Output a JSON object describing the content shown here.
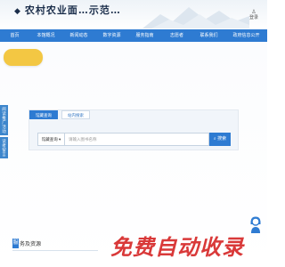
{
  "header": {
    "site_title": "农村农业面…示范…",
    "login_label": "登录"
  },
  "nav": {
    "items": [
      {
        "label": "首页"
      },
      {
        "label": "本馆概况"
      },
      {
        "label": "新闻动态"
      },
      {
        "label": "数字资源"
      },
      {
        "label": "服务指南"
      },
      {
        "label": "志愿者"
      },
      {
        "label": "联系我们"
      },
      {
        "label": "政府信息公开"
      }
    ]
  },
  "left_float": {
    "items": [
      {
        "label": "阅读推广活动"
      },
      {
        "label": "读者留言"
      }
    ]
  },
  "search": {
    "tabs": [
      {
        "label": "馆藏查询",
        "active": true
      },
      {
        "label": "站内搜索",
        "active": false
      }
    ],
    "select_value": "馆藏查询 ▾",
    "placeholder": "请输入图书名称",
    "button_label": "搜索"
  },
  "bottom": {
    "section_badge": "服",
    "section_title": "务及资源"
  },
  "watermark": "免费自动收录",
  "colors": {
    "primary": "#2e7bd2",
    "accent_yellow": "#f3c743",
    "watermark_red": "#d62828"
  }
}
